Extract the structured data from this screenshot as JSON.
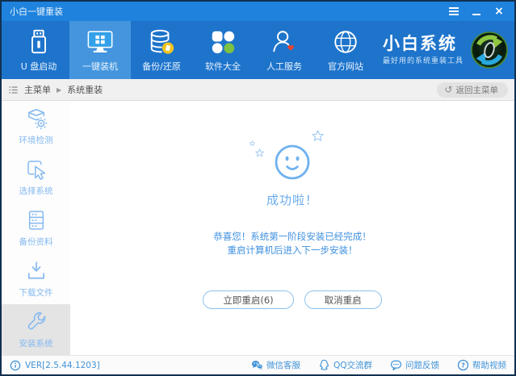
{
  "window": {
    "title": "小白一键重装"
  },
  "nav": {
    "items": [
      {
        "label": "U 盘启动",
        "icon": "usb-drive"
      },
      {
        "label": "一键装机",
        "icon": "monitor-windows",
        "active": true
      },
      {
        "label": "备份/还原",
        "icon": "database-backup"
      },
      {
        "label": "软件大全",
        "icon": "apps-clover"
      },
      {
        "label": "人工服务",
        "icon": "support-person"
      },
      {
        "label": "官方网站",
        "icon": "globe"
      }
    ],
    "brand": {
      "name": "小白系统",
      "tagline": "最好用的系统重装工具",
      "logo": "recycle-arrows-logo"
    }
  },
  "breadcrumb": {
    "root": "主菜单",
    "separator": "▶",
    "current": "系统重装",
    "back_label": "返回主菜单",
    "back_icon": "↺"
  },
  "sidebar": {
    "items": [
      {
        "label": "环境检测",
        "icon": "env-check"
      },
      {
        "label": "选择系统",
        "icon": "select-system"
      },
      {
        "label": "备份资料",
        "icon": "backup-data"
      },
      {
        "label": "下载文件",
        "icon": "download-files"
      },
      {
        "label": "安装系统",
        "icon": "install-system",
        "active": true
      }
    ]
  },
  "main": {
    "success_title": "成功啦！",
    "message_line1": "恭喜您！系统第一阶段安装已经完成！",
    "message_line2": "重启计算机后进入下一步安装！",
    "restart_now_label": "立即重启(6)",
    "restart_countdown": 6,
    "cancel_restart_label": "取消重启"
  },
  "statusbar": {
    "version": "VER[2.5.44.1203]",
    "links": [
      {
        "label": "微信客服",
        "icon": "wechat"
      },
      {
        "label": "QQ交流群",
        "icon": "qq"
      },
      {
        "label": "问题反馈",
        "icon": "feedback-bubble"
      },
      {
        "label": "帮助视频",
        "icon": "help-circle"
      }
    ]
  },
  "colors": {
    "titlebar": "#1f82dc",
    "navbar": "#1e74cb",
    "nav_active": "#4495de",
    "accent_blue": "#3f93d8",
    "content_blue": "#6fb2ef",
    "sidebar_icon_blue": "#85b9f0",
    "logo_green": "#8dc63f",
    "logo_blue": "#29a8df",
    "heart_red": "#e8432e",
    "badge_yellow": "#f3c41f",
    "apps_green": "#7cc142",
    "window_border": "#11304f"
  }
}
